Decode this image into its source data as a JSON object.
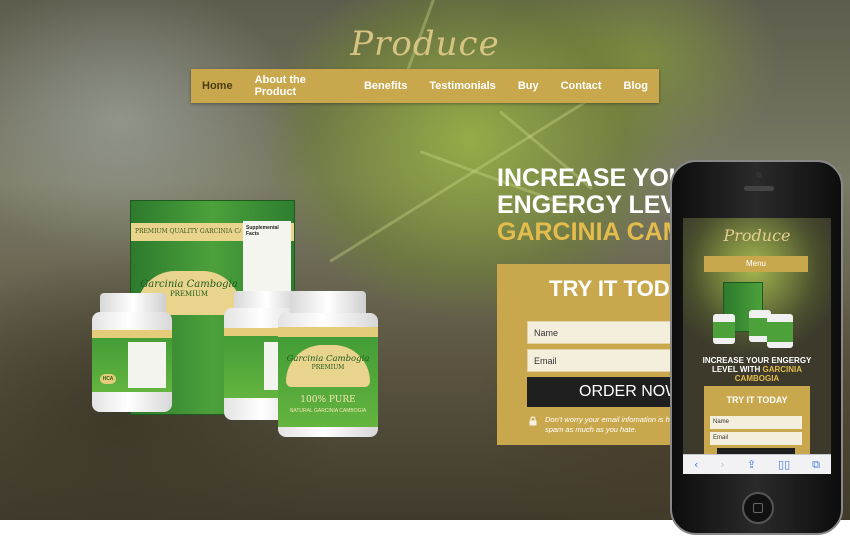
{
  "site": {
    "logo": "Produce",
    "nav": [
      {
        "label": "Home",
        "active": true
      },
      {
        "label": "About the Product",
        "active": false
      },
      {
        "label": "Benefits",
        "active": false
      },
      {
        "label": "Testimonials",
        "active": false
      },
      {
        "label": "Buy",
        "active": false
      },
      {
        "label": "Contact",
        "active": false
      },
      {
        "label": "Blog",
        "active": false
      }
    ],
    "headline_line1": "INCREASE YOUR",
    "headline_line2": "ENGERGY LEVEL",
    "headline_line3": "GARCINIA CAM",
    "form": {
      "title": "TRY IT TOD",
      "name_placeholder": "Name",
      "email_placeholder": "Email",
      "order_label": "ORDER NOW",
      "note": "Don't worry your email infomation is hate spam as much as you hate."
    },
    "product": {
      "box_top": "PREMIUM QUALITY GARCINIA CAMBOGIA",
      "brand": "Garcinia Cambogia",
      "premium": "PREMIUM",
      "pure": "100% PURE",
      "natural": "NATURAL GARCINIA CAMBOGIA",
      "hca": "HCA",
      "facts": "Supplemental Facts"
    }
  },
  "mobile": {
    "logo": "Produce",
    "menu_label": "Menu",
    "headline_line1": "INCREASE YOUR ENGERGY",
    "headline_line2_plain": "LEVEL WITH ",
    "headline_line2_accent": "GARCINIA",
    "headline_line3_accent": "CAMBOGIA",
    "form_title": "TRY IT TODAY",
    "name_placeholder": "Name",
    "email_placeholder": "Email",
    "safari_icons": [
      "back-icon",
      "forward-icon",
      "share-icon",
      "bookmarks-icon",
      "tabs-icon"
    ]
  },
  "colors": {
    "accent": "#c9a84d",
    "headline_accent": "#e4bc4c",
    "button": "#1f1f1f"
  }
}
